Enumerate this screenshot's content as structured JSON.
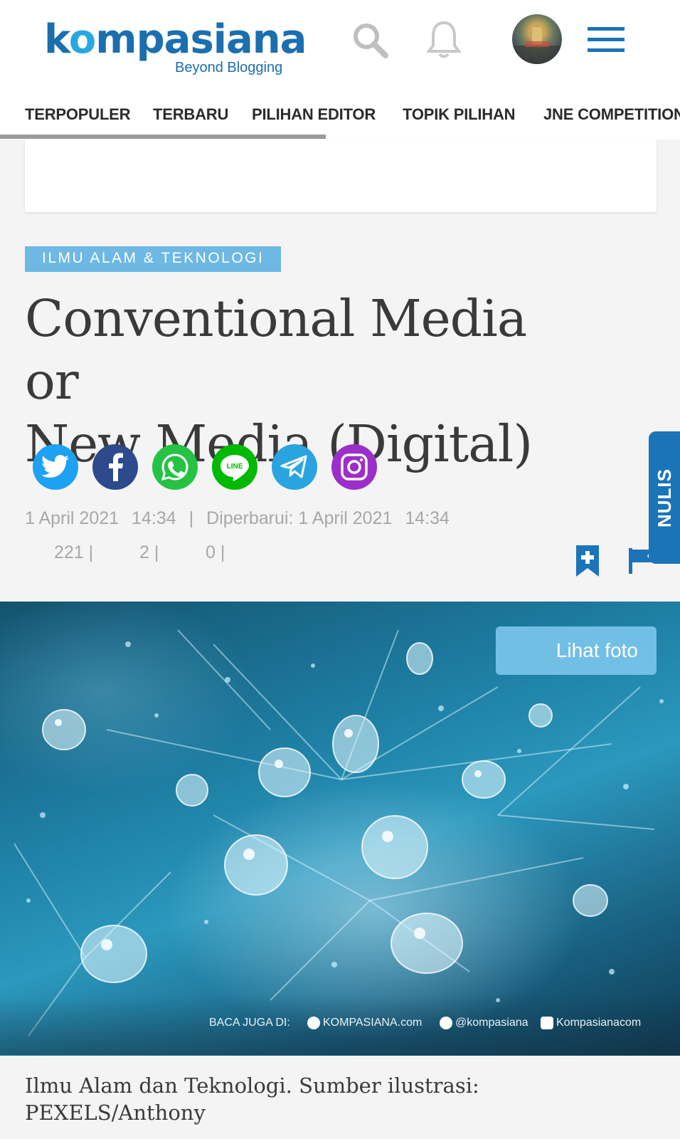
{
  "header": {
    "logo_text": "kompasiana",
    "logo_tagline": "Beyond Blogging"
  },
  "nav": {
    "items": [
      "TERPOPULER",
      "TERBARU",
      "PILIHAN EDITOR",
      "TOPIK PILIHAN",
      "JNE COMPETITION"
    ]
  },
  "article": {
    "category": "ILMU ALAM & TEKNOLOGI",
    "title_line1": "Conventional Media or",
    "title_line2": "New Media (Digital)",
    "date": "1 April 2021",
    "time": "14:34",
    "updated_label": "Diperbarui: 1 April 2021",
    "updated_time": "14:34",
    "views": "221",
    "comments": "2",
    "votes": "0",
    "nulis_label": "NULIS",
    "photo_button": "Lihat foto",
    "watermark_prefix": "BACA JUGA DI:",
    "watermark_fb": "KOMPASIANA.com",
    "watermark_tw": "@kompasiana",
    "watermark_ig": "Kompasianacom",
    "caption": "Ilmu Alam dan Teknologi. Sumber ilustrasi: PEXELS/Anthony"
  },
  "share": {
    "twitter_color": "#1da1f2",
    "facebook_color": "#2c4a8c",
    "whatsapp_color": "#25c243",
    "line_color": "#00b900",
    "telegram_color": "#2aa4e0",
    "instagram_color": "#9b2fc9"
  }
}
